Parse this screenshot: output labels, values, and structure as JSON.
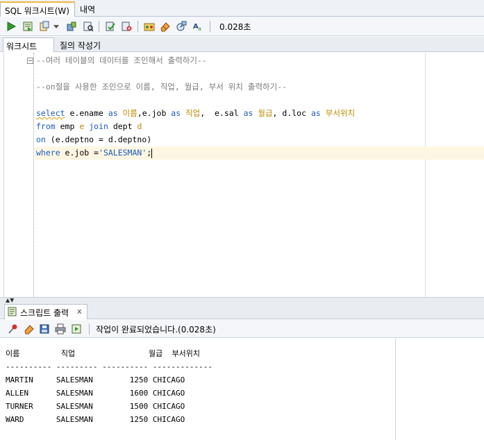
{
  "top_tabs": {
    "worksheet": "SQL 워크시트(W)",
    "history": "내역"
  },
  "toolbar": {
    "elapsed": "0.028초"
  },
  "sub_tabs": {
    "worksheet": "워크시트",
    "query_builder": "질의 작성기"
  },
  "editor": {
    "line1": "--여러 테이블의 데이터를 조인해서 출력하기--",
    "line2": "--on절을 사용한 조인으로 이름, 직업, 월급, 부서 위치 출력하기--",
    "line3": {
      "select": "select",
      "a": " e.ename ",
      "as1": "as",
      "sp1": " ",
      "alias1": "이름",
      "b": ",e.job ",
      "as2": "as",
      "sp2": " ",
      "alias2": "직업",
      "c": ",  e.sal ",
      "as3": "as",
      "sp3": " ",
      "alias3": "월급",
      "d": ", d.loc ",
      "as4": "as",
      "sp4": " ",
      "alias4": "부서위치"
    },
    "line4": {
      "from": "from",
      "a": " emp ",
      "e": "e",
      "sp": " ",
      "join": "join",
      "b": " dept ",
      "d": "d"
    },
    "line5": {
      "on": "on",
      "a": " (e.deptno = d.deptno)"
    },
    "line6": {
      "where": "where",
      "a": " e.job =",
      "str": "'SALESMAN'",
      "end": ";"
    }
  },
  "output": {
    "tab_label": "스크립트 출력",
    "close": "x",
    "status": "작업이 완료되었습니다.(0.028초)",
    "lines": [
      "이름         직업                월급  부서위치",
      "---------- --------- ---------- -------------",
      "MARTIN     SALESMAN        1250 CHICAGO",
      "ALLEN      SALESMAN        1600 CHICAGO",
      "TURNER     SALESMAN        1500 CHICAGO",
      "WARD       SALESMAN        1250 CHICAGO"
    ]
  },
  "colors": {
    "keyword": "#1a5cbf",
    "comment": "#7a7a7a",
    "alias": "#c08a00",
    "active_tab_accent": "#f0b443"
  },
  "icons": [
    "run-icon",
    "run-script-icon",
    "commit-icon",
    "dropdown-icon",
    "autotrace-icon",
    "explain-plan-icon",
    "commit-check-icon",
    "rollback-icon",
    "sql-tuning-icon",
    "eraser-icon",
    "monitor-icon",
    "format-icon",
    "pin-icon",
    "clear-icon",
    "save-icon",
    "print-icon",
    "export-icon",
    "script-output-icon"
  ]
}
